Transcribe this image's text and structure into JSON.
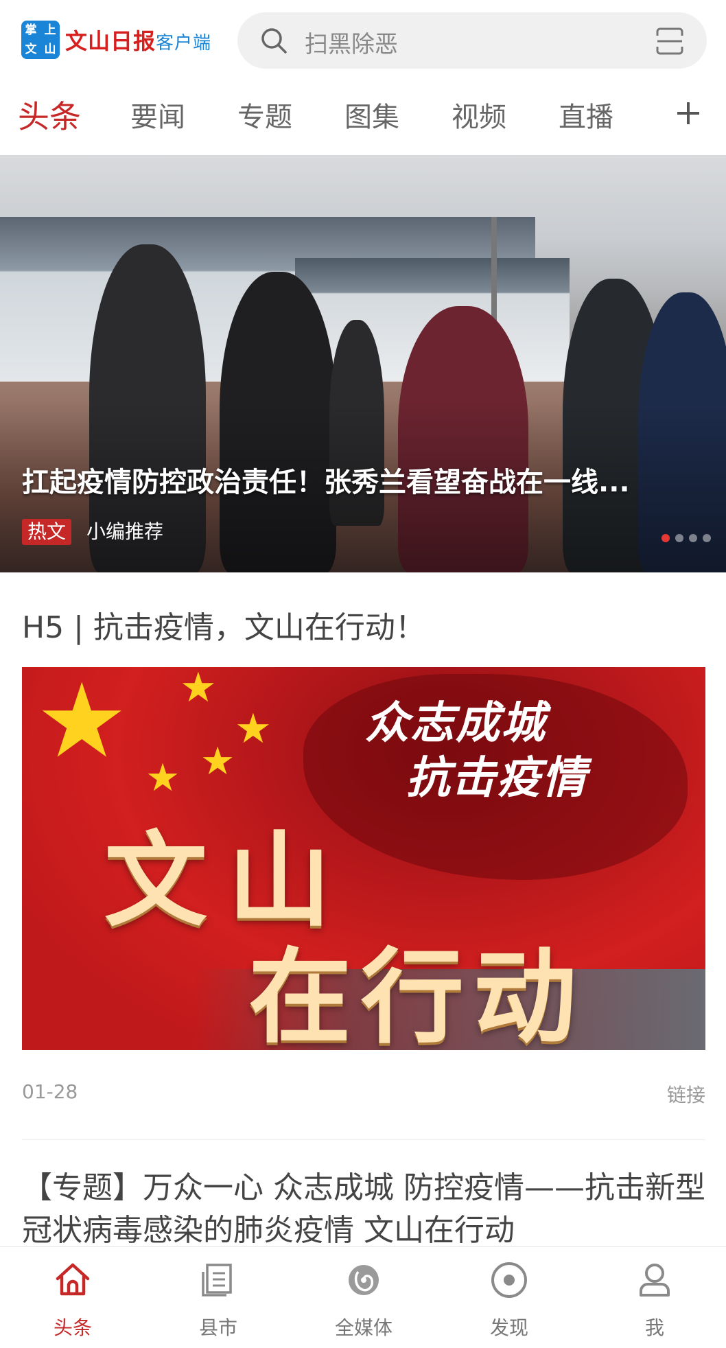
{
  "header": {
    "logo_badge": [
      "掌",
      "上",
      "文",
      "山"
    ],
    "logo_main": "文山日报",
    "logo_sub": "客户端",
    "search_placeholder": "扫黑除恶"
  },
  "tabs": [
    {
      "label": "头条",
      "active": true
    },
    {
      "label": "要闻"
    },
    {
      "label": "专题"
    },
    {
      "label": "图集"
    },
    {
      "label": "视频"
    },
    {
      "label": "直播"
    }
  ],
  "hero": {
    "title": "扛起疫情防控政治责任！张秀兰看望奋战在一线...",
    "badge": "热文",
    "source": "小编推荐",
    "slides": 4,
    "active_slide": 1
  },
  "articles": [
    {
      "title": "H5 | 抗击疫情，文山在行动！",
      "image_text": {
        "slogan_line1": "众志成城",
        "slogan_line2": "抗击疫情",
        "big_line1": "文山",
        "big_line2": "在行动"
      },
      "date": "01-28",
      "type": "链接"
    },
    {
      "title": "【专题】万众一心 众志成城 防控疫情——抗击新型冠状病毒感染的肺炎疫情 文山在行动"
    }
  ],
  "bottom_nav": [
    {
      "label": "头条",
      "icon": "home-icon",
      "active": true
    },
    {
      "label": "县市",
      "icon": "county-icon"
    },
    {
      "label": "全媒体",
      "icon": "media-icon"
    },
    {
      "label": "发现",
      "icon": "discover-icon"
    },
    {
      "label": "我",
      "icon": "profile-icon"
    }
  ],
  "colors": {
    "accent": "#c62828",
    "brand_blue": "#1a84d6"
  }
}
